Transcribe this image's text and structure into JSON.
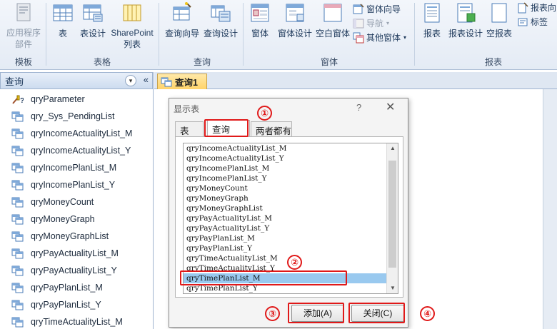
{
  "ribbon": {
    "buttons": {
      "app_parts": "应用程序\n部件",
      "table": "表",
      "table_design": "表设计",
      "sharepoint": "SharePoint\n列表",
      "query_wizard": "查询向导",
      "query_design": "查询设计",
      "form": "窗体",
      "form_design": "窗体设计",
      "blank_form": "空白窗体",
      "form_wizard": "窗体向导",
      "navigation": "导航",
      "more_forms": "其他窗体",
      "report": "报表",
      "report_design": "报表设计",
      "blank_report": "空报表",
      "report_wizard": "报表向",
      "labels": "标签"
    },
    "groups": {
      "templates": "模板",
      "tables": "表格",
      "queries": "查询",
      "forms": "窗体",
      "reports": "报表"
    }
  },
  "nav": {
    "title": "查询",
    "items": [
      {
        "label": "qryParameter",
        "icon": "parameter-query-icon"
      },
      {
        "label": "qry_Sys_PendingList",
        "icon": "query-icon"
      },
      {
        "label": "qryIncomeActualityList_M",
        "icon": "query-icon"
      },
      {
        "label": "qryIncomeActualityList_Y",
        "icon": "query-icon"
      },
      {
        "label": "qryIncomePlanList_M",
        "icon": "query-icon"
      },
      {
        "label": "qryIncomePlanList_Y",
        "icon": "query-icon"
      },
      {
        "label": "qryMoneyCount",
        "icon": "query-icon"
      },
      {
        "label": "qryMoneyGraph",
        "icon": "query-icon"
      },
      {
        "label": "qryMoneyGraphList",
        "icon": "query-icon"
      },
      {
        "label": "qryPayActualityList_M",
        "icon": "query-icon"
      },
      {
        "label": "qryPayActualityList_Y",
        "icon": "query-icon"
      },
      {
        "label": "qryPayPlanList_M",
        "icon": "query-icon"
      },
      {
        "label": "qryPayPlanList_Y",
        "icon": "query-icon"
      },
      {
        "label": "qryTimeActualityList_M",
        "icon": "query-icon"
      }
    ]
  },
  "document": {
    "tab_title": "查询1"
  },
  "dialog": {
    "title": "显示表",
    "help": "?",
    "close": "✕",
    "tabs": [
      "表",
      "查询",
      "两者都有"
    ],
    "active_tab": "查询",
    "list_items": [
      "qryIncomeActualityList_M",
      "qryIncomeActualityList_Y",
      "qryIncomePlanList_M",
      "qryIncomePlanList_Y",
      "qryMoneyCount",
      "qryMoneyGraph",
      "qryMoneyGraphList",
      "qryPayActualityList_M",
      "qryPayActualityList_Y",
      "qryPayPlanList_M",
      "qryPayPlanList_Y",
      "qryTimeActualityList_M",
      "qryTimeActualityList_Y",
      "qryTimePlanList_M",
      "qryTimePlanList_Y"
    ],
    "selected_item": "qryTimePlanList_M",
    "add_button": "添加(A)",
    "close_button": "关闭(C)"
  },
  "annotations": {
    "step1": "①",
    "step2": "②",
    "step3": "③",
    "step4": "④",
    "color": "#e01919"
  }
}
